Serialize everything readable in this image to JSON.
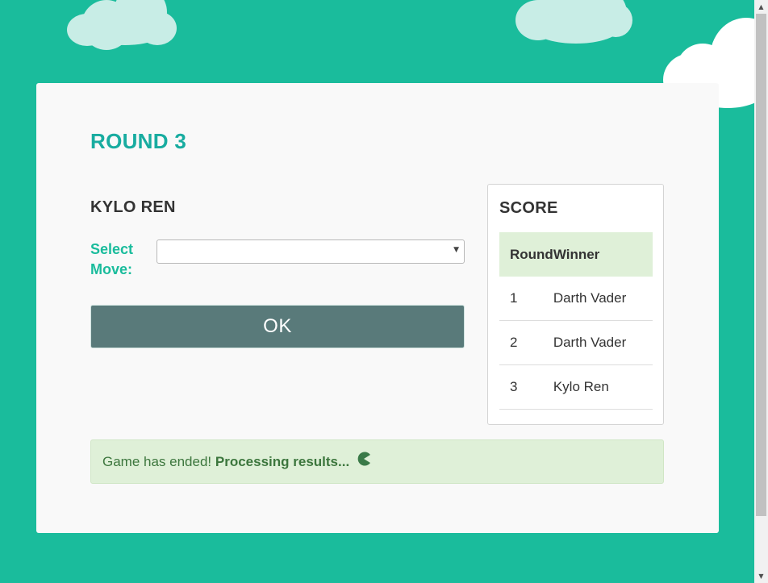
{
  "game": {
    "round_title": "ROUND 3",
    "player_name": "KYLO REN",
    "move_label": "Select Move:",
    "move_value": "",
    "ok_label": "OK"
  },
  "score": {
    "title": "SCORE",
    "headers": [
      "Round",
      "Winner"
    ],
    "rows": [
      {
        "round": "1",
        "winner": "Darth Vader"
      },
      {
        "round": "2",
        "winner": "Darth Vader"
      },
      {
        "round": "3",
        "winner": "Kylo Ren"
      }
    ]
  },
  "alert": {
    "text": "Game has ended!",
    "strong_text": "Processing results...",
    "icon": "pacman-loader-icon"
  },
  "colors": {
    "background": "#1abc9c",
    "accent": "#18aca0",
    "button": "#597a7a",
    "success_bg": "#dff0d8",
    "success_text": "#3c763d"
  }
}
